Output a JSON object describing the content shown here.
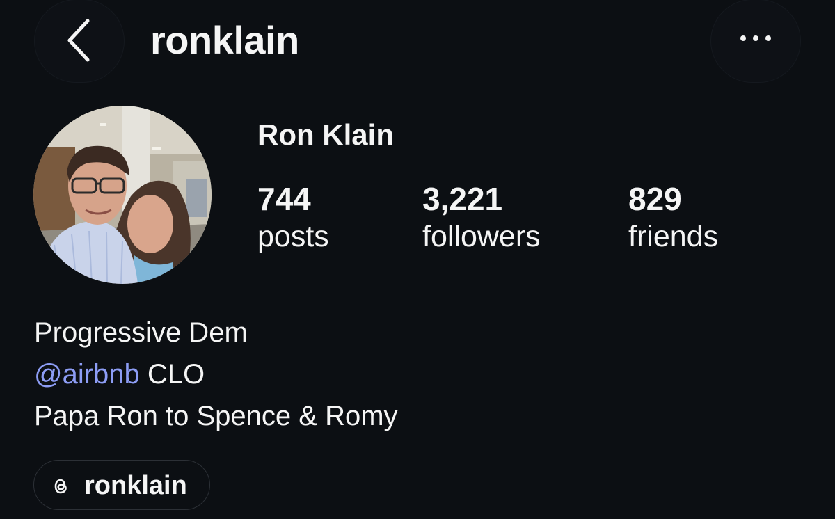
{
  "header": {
    "back_icon": "chevron-left-icon",
    "username": "ronklain",
    "more_icon": "more-horizontal-icon"
  },
  "profile": {
    "avatar": "profile-photo",
    "display_name": "Ron Klain",
    "stats": [
      {
        "value": "744",
        "label": "posts"
      },
      {
        "value": "3,221",
        "label": "followers"
      },
      {
        "value": "829",
        "label": "friends"
      }
    ]
  },
  "bio": {
    "line1": "Progressive Dem",
    "line2_mention": "@airbnb",
    "line2_rest": " CLO",
    "line3": "Papa Ron to Spence & Romy"
  },
  "threads_link": {
    "icon": "threads-icon",
    "handle": "ronklain"
  },
  "colors": {
    "background": "#0c0f13",
    "text": "#f5f5f5",
    "mention": "#8d9df5"
  }
}
